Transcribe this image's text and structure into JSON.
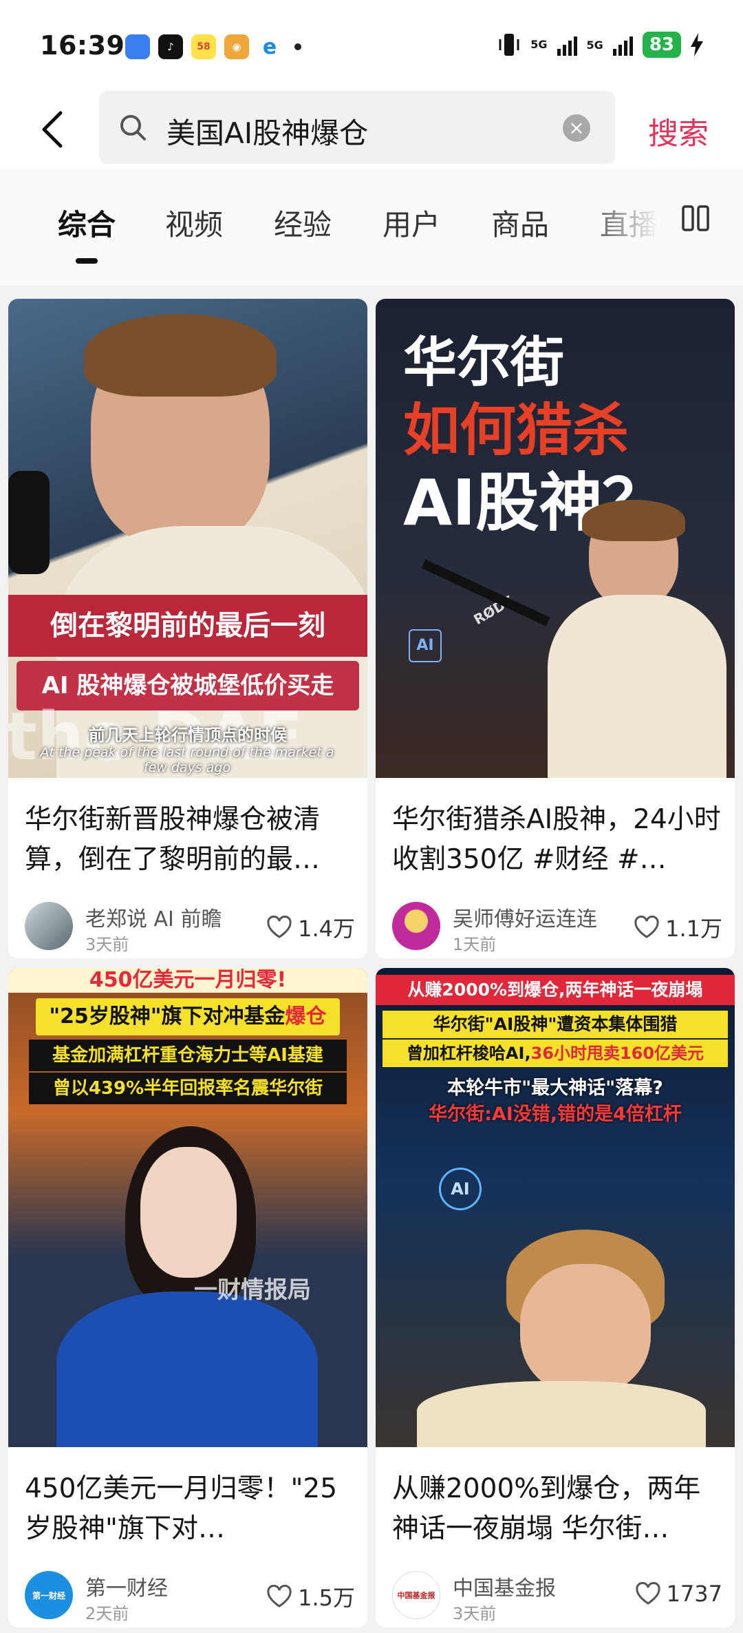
{
  "status": {
    "time": "16:39",
    "apps": [
      {
        "name": "maps-icon",
        "label": "",
        "color": "#3a7ef0"
      },
      {
        "name": "tiktok-icon",
        "label": "♪",
        "color": "#111111"
      },
      {
        "name": "58-icon",
        "label": "58",
        "color": "#ffe14a"
      },
      {
        "name": "weibo-icon",
        "label": "◉",
        "color": "#f0a73a"
      },
      {
        "name": "edge-icon",
        "label": "e",
        "color": "#ffffff"
      }
    ],
    "net1": "5G",
    "net2": "5G",
    "battery": "83"
  },
  "search": {
    "query": "美国AI股神爆仓",
    "button": "搜索",
    "clear": "×"
  },
  "tabs": [
    "综合",
    "视频",
    "经验",
    "用户",
    "商品",
    "直播"
  ],
  "cards": [
    {
      "title": "华尔街新晋股神爆仓被清算，倒在了黎明前的最…",
      "author": "老郑说 AI 前瞻",
      "ago": "3天前",
      "likes": "1.4万",
      "overlay": {
        "line1": "倒在黎明前的最后一刻",
        "line2": "AI 股神爆仓被城堡低价买走",
        "caption_cn": "前几天上轮行情顶点的时候",
        "caption_en": "At the peak of the last round of the market a few days ago",
        "corner": "the DAE"
      }
    },
    {
      "title": "华尔街猎杀AI股神，24小时收割350亿 #财经 #…",
      "author": "吴师傅好运连连",
      "ago": "1天前",
      "likes": "1.1万",
      "overlay": {
        "line1": "华尔街",
        "line2": "如何猎杀",
        "line3": "AI股神？",
        "mic": "RØDE",
        "badge": "AI"
      }
    },
    {
      "title": "450亿美元一月归零！\"25岁股神\"旗下对…",
      "author": "第一财经",
      "ago": "2天前",
      "likes": "1.5万",
      "overlay": {
        "line1": "450亿美元一月归零!",
        "line2a": "\"25岁股神\"旗下对冲基金",
        "line2b": "爆仓",
        "line3": "基金加满杠杆重仓海力士等AI基建",
        "line4": "曾以439%半年回报率名震华尔街",
        "watermark": "一财情报局",
        "avatar_label": "第一财经"
      }
    },
    {
      "title": "从赚2000%到爆仓，两年神话一夜崩塌 华尔街…",
      "author": "中国基金报",
      "ago": "3天前",
      "likes": "1737",
      "overlay": {
        "line1": "从赚2000%到爆仓,两年神话一夜崩塌",
        "line2": "华尔街\"AI股神\"遭资本集体围猎",
        "line3a": "曾加杠杆梭哈AI,",
        "line3b": "36小时甩卖160亿美元",
        "line4": "本轮牛市\"最大神话\"落幕?",
        "line5": "华尔街:AI没错,错的是4倍杠杆",
        "badge": "AI",
        "avatar_label": "中国基金报"
      }
    }
  ],
  "colors": {
    "accent": "#e0335a",
    "overlay_red": "#c8283a",
    "overlay_yellow": "#f5e12a"
  }
}
